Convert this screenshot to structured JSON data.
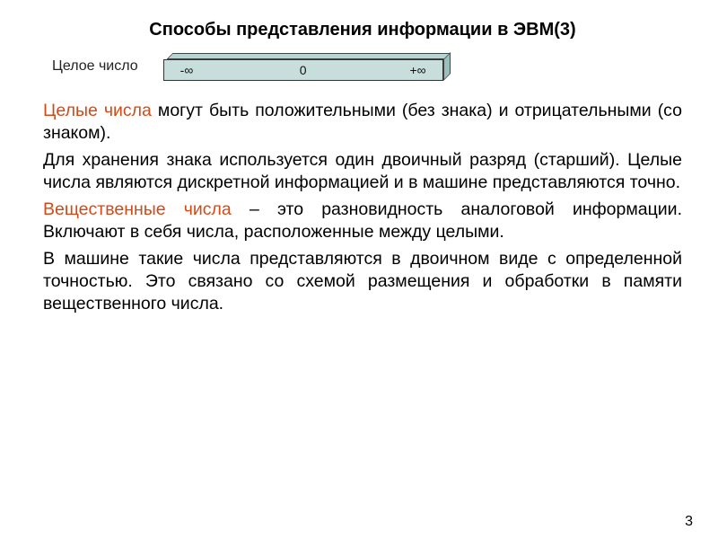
{
  "title": "Способы представления информации в ЭВМ(3)",
  "figure": {
    "label": "Целое число",
    "minus": "-∞",
    "zero": "0",
    "plus": "+∞"
  },
  "para1_red": "Целые числа",
  "para1_rest": " могут быть положительными (без знака) и отрицательными (со знаком).",
  "para2": "Для хранения знака используется один двоичный разряд (старший). Целые числа являются дискретной информацией и в машине представляются точно.",
  "para3_red": "Вещественные числа",
  "para3_rest": " – это разновидность аналоговой информации. Включают в себя числа, расположенные между целыми.",
  "para4": " В машине такие числа представляются в двоичном виде с определенной точностью. Это связано со схемой размещения и обработки в памяти вещественного числа.",
  "page_number": "3"
}
